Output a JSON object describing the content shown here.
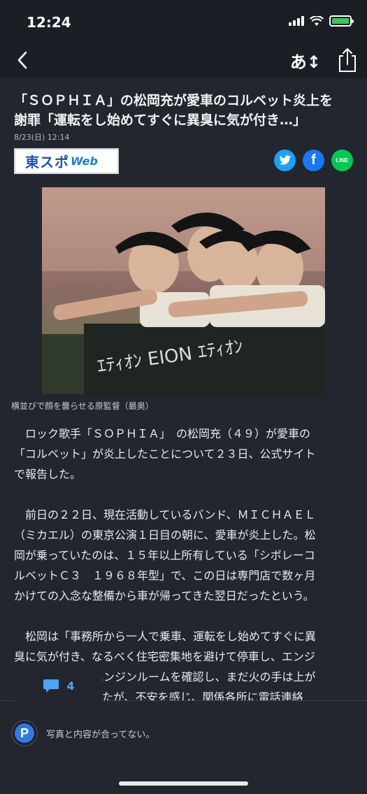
{
  "status_bar": {
    "time": "12:24"
  },
  "nav": {
    "back_icon": "chevron-left-icon",
    "font_size_label": "あ↕",
    "share_icon": "share-icon"
  },
  "article": {
    "headline_lines": [
      "「ＳＯＰＨＩＡ」の松岡充が愛車のコルベット炎上を",
      "謝罪「運転をし始めてすぐに異臭に気が付き…」"
    ],
    "date": "8/23(日) 12:14",
    "source_logo": {
      "main": "東スポ",
      "web": "Web"
    },
    "social": [
      "twitter-icon",
      "facebook-icon",
      "line-icon"
    ],
    "social_line_label": "LINE",
    "social_facebook_label": "f",
    "photo_caption": "横並びで顔を曇らせる原監督（最奥）",
    "paragraphs": [
      [
        "　ロック歌手「ＳＯＰＨＩＡ」　の松岡充（４９）が愛車の",
        "「コルベット」が炎上したことについて２３日、公式サイト",
        "で報告した。"
      ],
      [
        "　前日の２２日、現在活動しているバンド、ＭＩＣＨＡＥＬ",
        "（ミカエル）の東京公演１日目の朝に、愛車が炎上した。松",
        "岡が乗っていたのは、１５年以上所有している「シボレーコ",
        "ルベットＣ３　１９６８年型」で、この日は専門店で数ヶ月",
        "かけての入念な整備から車が帰ってきた翌日だったという。"
      ],
      [
        "　松岡は「事務所から一人で乗車、運転をし始めてすぐに異",
        "臭に気が付き、なるべく住宅密集地を避けて停車し、エンジ",
        "ンを停止させ、エンジンルームを確認し、まだ火の手は上が",
        "っていませんでしたが、不安を感じ、関係各所に電話連絡"
      ]
    ]
  },
  "comments": {
    "count": "4",
    "icon": "comment-bubble-icon",
    "avatar_letter": "P",
    "latest_comment": "写真と内容が合ってない。"
  }
}
